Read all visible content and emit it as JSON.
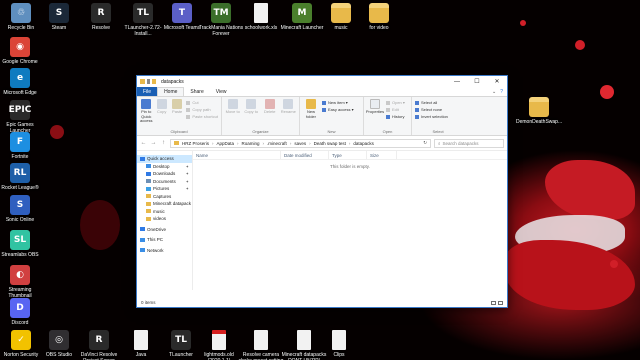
{
  "desktop": {
    "icons_top": [
      {
        "label": "Recycle Bin",
        "glyph": "♲",
        "color": "#5f8fbf"
      },
      {
        "label": "Steam",
        "glyph": "S",
        "color": "#1b2838"
      },
      {
        "label": "Resolve",
        "glyph": "R",
        "color": "#2a2a2a"
      },
      {
        "label": "TLauncher-2.72-Install...",
        "glyph": "TL",
        "color": "#2a2a2a"
      },
      {
        "label": "Microsoft Teams",
        "glyph": "T",
        "color": "#5b5fc7"
      },
      {
        "label": "TrackMania Nations Forever",
        "glyph": "TM",
        "color": "#3b6e2a"
      },
      {
        "label": "schoolwork.xls",
        "glyph": "",
        "color": "#f2f2f2"
      },
      {
        "label": "Minecraft Launcher",
        "glyph": "M",
        "color": "#4a7f2c"
      },
      {
        "label": "music",
        "glyph": "",
        "color": "#e8b94a"
      },
      {
        "label": "for video",
        "glyph": "",
        "color": "#e8b94a"
      }
    ],
    "icons_left": [
      {
        "label": "Google Chrome",
        "glyph": "◉",
        "color": "#db4437"
      },
      {
        "label": "Microsoft Edge",
        "glyph": "e",
        "color": "#0f7bc0"
      },
      {
        "label": "Epic Games Launcher",
        "glyph": "EPIC",
        "color": "#2a2a2a"
      },
      {
        "label": "Fortnite",
        "glyph": "F",
        "color": "#1d8fe1"
      },
      {
        "label": "Rocket League®",
        "glyph": "RL",
        "color": "#1e5fa8"
      },
      {
        "label": "Sonic Online",
        "glyph": "S",
        "color": "#2f5fbf"
      },
      {
        "label": "Streamlabs OBS",
        "glyph": "SL",
        "color": "#31c3a2"
      },
      {
        "label": "Streaming Thumbnail",
        "glyph": "◐",
        "color": "#d14040"
      },
      {
        "label": "Discord",
        "glyph": "D",
        "color": "#5865f2"
      }
    ],
    "icons_bottom": [
      {
        "label": "Norton Security",
        "glyph": "✓",
        "color": "#f2c200"
      },
      {
        "label": "OBS Studio",
        "glyph": "◎",
        "color": "#302e31"
      },
      {
        "label": "DaVinci Resolve Project Server",
        "glyph": "R",
        "color": "#2a2a2a"
      },
      {
        "label": "Java",
        "glyph": "",
        "color": "#f2f2f2"
      },
      {
        "label": "TLauncher",
        "glyph": "TL",
        "color": "#2a2a2a"
      },
      {
        "label": "lightmods.old (2020.1.1)",
        "glyph": "",
        "color": "#d62020"
      },
      {
        "label": "Resolve camera shake preset.setting",
        "glyph": "",
        "color": "#f2f2f2"
      },
      {
        "label": "Minecraft datapacks DONT UNZIP!",
        "glyph": "",
        "color": "#f2f2f2"
      },
      {
        "label": "Clips",
        "glyph": "",
        "color": "#f2f2f2"
      }
    ],
    "icon_right": {
      "label": "DemonDeathSwap...",
      "glyph": "",
      "color": "#e8b94a"
    }
  },
  "window": {
    "title": "datapacks",
    "controls": {
      "minimize": "—",
      "maximize": "☐",
      "close": "✕"
    },
    "tabs": [
      "File",
      "Home",
      "Share",
      "View"
    ],
    "ribbon": {
      "clipboard": {
        "name": "Clipboard",
        "pin": "Pin to Quick access",
        "copy": "Copy",
        "paste": "Paste",
        "cut": "Cut",
        "copy_path": "Copy path",
        "paste_shortcut": "Paste shortcut"
      },
      "organize": {
        "name": "Organize",
        "move_to": "Move to",
        "copy_to": "Copy to",
        "delete": "Delete",
        "rename": "Rename"
      },
      "new": {
        "name": "New",
        "new_folder": "New folder",
        "new_item": "New item ▾",
        "easy_access": "Easy access ▾"
      },
      "open": {
        "name": "Open",
        "properties": "Properties",
        "open": "Open ▾",
        "edit": "Edit",
        "history": "History"
      },
      "select": {
        "name": "Select",
        "select_all": "Select all",
        "select_none": "Select none",
        "invert": "Invert selection"
      }
    },
    "address": {
      "nav_back": "←",
      "nav_forward": "→",
      "nav_up": "↑",
      "path": [
        "HRZ Proseris",
        "AppData",
        "Roaming",
        ".minecraft",
        "saves",
        "Death swap test",
        "datapacks"
      ],
      "refresh": "↻",
      "search_placeholder": "Search datapacks"
    },
    "navpane": [
      {
        "label": "Quick access",
        "level": 0,
        "pinned": false,
        "icon": "star-icon",
        "color": "#2f7ae5",
        "selected": true
      },
      {
        "label": "Desktop",
        "level": 1,
        "pinned": true,
        "icon": "desktop-icon",
        "color": "#3a8ee6"
      },
      {
        "label": "Downloads",
        "level": 1,
        "pinned": true,
        "icon": "download-icon",
        "color": "#2f7ae5"
      },
      {
        "label": "Documents",
        "level": 1,
        "pinned": true,
        "icon": "document-icon",
        "color": "#6d8fb5"
      },
      {
        "label": "Pictures",
        "level": 1,
        "pinned": true,
        "icon": "picture-icon",
        "color": "#3aa0e6"
      },
      {
        "label": "Captures",
        "level": 1,
        "pinned": false,
        "icon": "folder-icon",
        "color": "#e8b94a"
      },
      {
        "label": "Minecraft datapack",
        "level": 1,
        "pinned": false,
        "icon": "folder-icon",
        "color": "#e8b94a"
      },
      {
        "label": "music",
        "level": 1,
        "pinned": false,
        "icon": "folder-icon",
        "color": "#e8b94a"
      },
      {
        "label": "videos",
        "level": 1,
        "pinned": false,
        "icon": "folder-icon",
        "color": "#e8b94a"
      },
      {
        "label": "OneDrive",
        "level": 0,
        "pinned": false,
        "icon": "cloud-icon",
        "color": "#2f7ae5",
        "gap": true
      },
      {
        "label": "This PC",
        "level": 0,
        "pinned": false,
        "icon": "computer-icon",
        "color": "#3a8ee6",
        "gap": true
      },
      {
        "label": "Network",
        "level": 0,
        "pinned": false,
        "icon": "network-icon",
        "color": "#3a8ee6",
        "gap": true
      }
    ],
    "pin_glyph": "✦",
    "columns": [
      "Name",
      "Date modified",
      "Type",
      "Size"
    ],
    "empty_text": "This folder is empty.",
    "status": "0 items"
  }
}
